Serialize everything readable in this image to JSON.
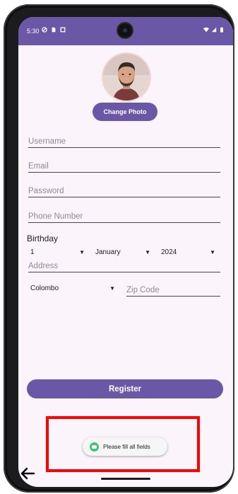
{
  "status": {
    "time": "5:30"
  },
  "profile": {
    "change_photo_label": "Change Photo"
  },
  "form": {
    "username_placeholder": "Username",
    "email_placeholder": "Email",
    "password_placeholder": "Password",
    "phone_placeholder": "Phone Number",
    "birthday_label": "Birthday",
    "birthday_day": "1",
    "birthday_month": "January",
    "birthday_year": "2024",
    "address_placeholder": "Address",
    "city_selected": "Colombo",
    "zip_placeholder": "Zip Code",
    "register_label": "Register"
  },
  "toast": {
    "message": "Please fill all fields"
  },
  "colors": {
    "primary": "#6a58a6",
    "background": "#fbf4fb",
    "highlight": "#ff0000",
    "toast_icon": "#3ec47b"
  }
}
